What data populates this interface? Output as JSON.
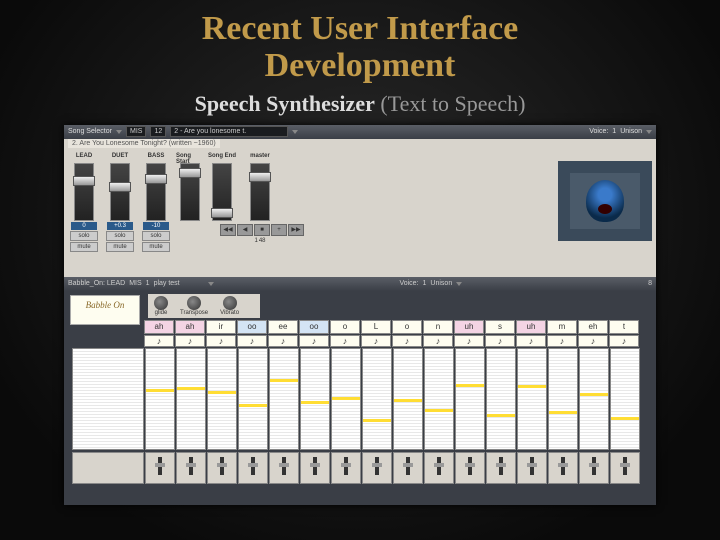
{
  "title_line1": "Recent User Interface",
  "title_line2": "Development",
  "subtitle_bold": "Speech Synthesizer",
  "subtitle_light": " (Text to Speech)",
  "topbar": {
    "label": "Song Selector",
    "dd1": "MIS",
    "num": "12",
    "song": "2 - Are you lonesome t.",
    "voicelbl": "Voice:",
    "voice": "1",
    "unisonlbl": "Unison"
  },
  "songline": "2. Are You Lonesome Tonight? (written ~1960)",
  "mixer": {
    "cols": [
      {
        "h": "LEAD",
        "val": "0",
        "solo": "solo",
        "mute": "mute",
        "knob": 12
      },
      {
        "h": "DUET",
        "val": "+0.3",
        "solo": "solo",
        "mute": "mute",
        "knob": 18
      },
      {
        "h": "BASS",
        "val": "-10",
        "solo": "solo",
        "mute": "mute",
        "knob": 10
      }
    ],
    "songstart": {
      "h": "Song Start"
    },
    "songend": {
      "h": "Song End"
    },
    "master": {
      "h": "master",
      "knob": 8
    }
  },
  "transport": [
    "◀◀",
    "◀",
    "■",
    "+",
    "▶▶"
  ],
  "playing": "1",
  "barlen": "48",
  "midbar": {
    "label": "Babble_On: LEAD",
    "dd1": "MIS",
    "num": "1",
    "song": "play test",
    "voicelbl": "Voice:",
    "voice": "1",
    "unisonlbl": "Unison",
    "right": "8"
  },
  "knobs": [
    "glide",
    "Transpose",
    "Vibrato"
  ],
  "babble": "Babble On",
  "phonemes": [
    {
      "t": "ah",
      "c": "pink"
    },
    {
      "t": "ah",
      "c": "pink"
    },
    {
      "t": "ir",
      "c": ""
    },
    {
      "t": "oo",
      "c": "blue"
    },
    {
      "t": "ee",
      "c": ""
    },
    {
      "t": "oo",
      "c": "blue"
    },
    {
      "t": "o",
      "c": ""
    },
    {
      "t": "L",
      "c": ""
    },
    {
      "t": "o",
      "c": ""
    },
    {
      "t": "n",
      "c": ""
    },
    {
      "t": "uh",
      "c": "pink"
    },
    {
      "t": "s",
      "c": ""
    },
    {
      "t": "uh",
      "c": "pink"
    },
    {
      "t": "m",
      "c": ""
    },
    {
      "t": "eh",
      "c": ""
    },
    {
      "t": "t",
      "c": ""
    }
  ],
  "notes": [
    "♪",
    "♪",
    "♪",
    "♪",
    "♪",
    "♪",
    "♪",
    "♪",
    "♪",
    "♪",
    "♪",
    "♪",
    "♪",
    "♪",
    "♪",
    "♪"
  ],
  "yelpos": [
    40,
    38,
    42,
    55,
    30,
    52,
    48,
    70,
    50,
    60,
    35,
    65,
    36,
    62,
    44,
    68
  ]
}
